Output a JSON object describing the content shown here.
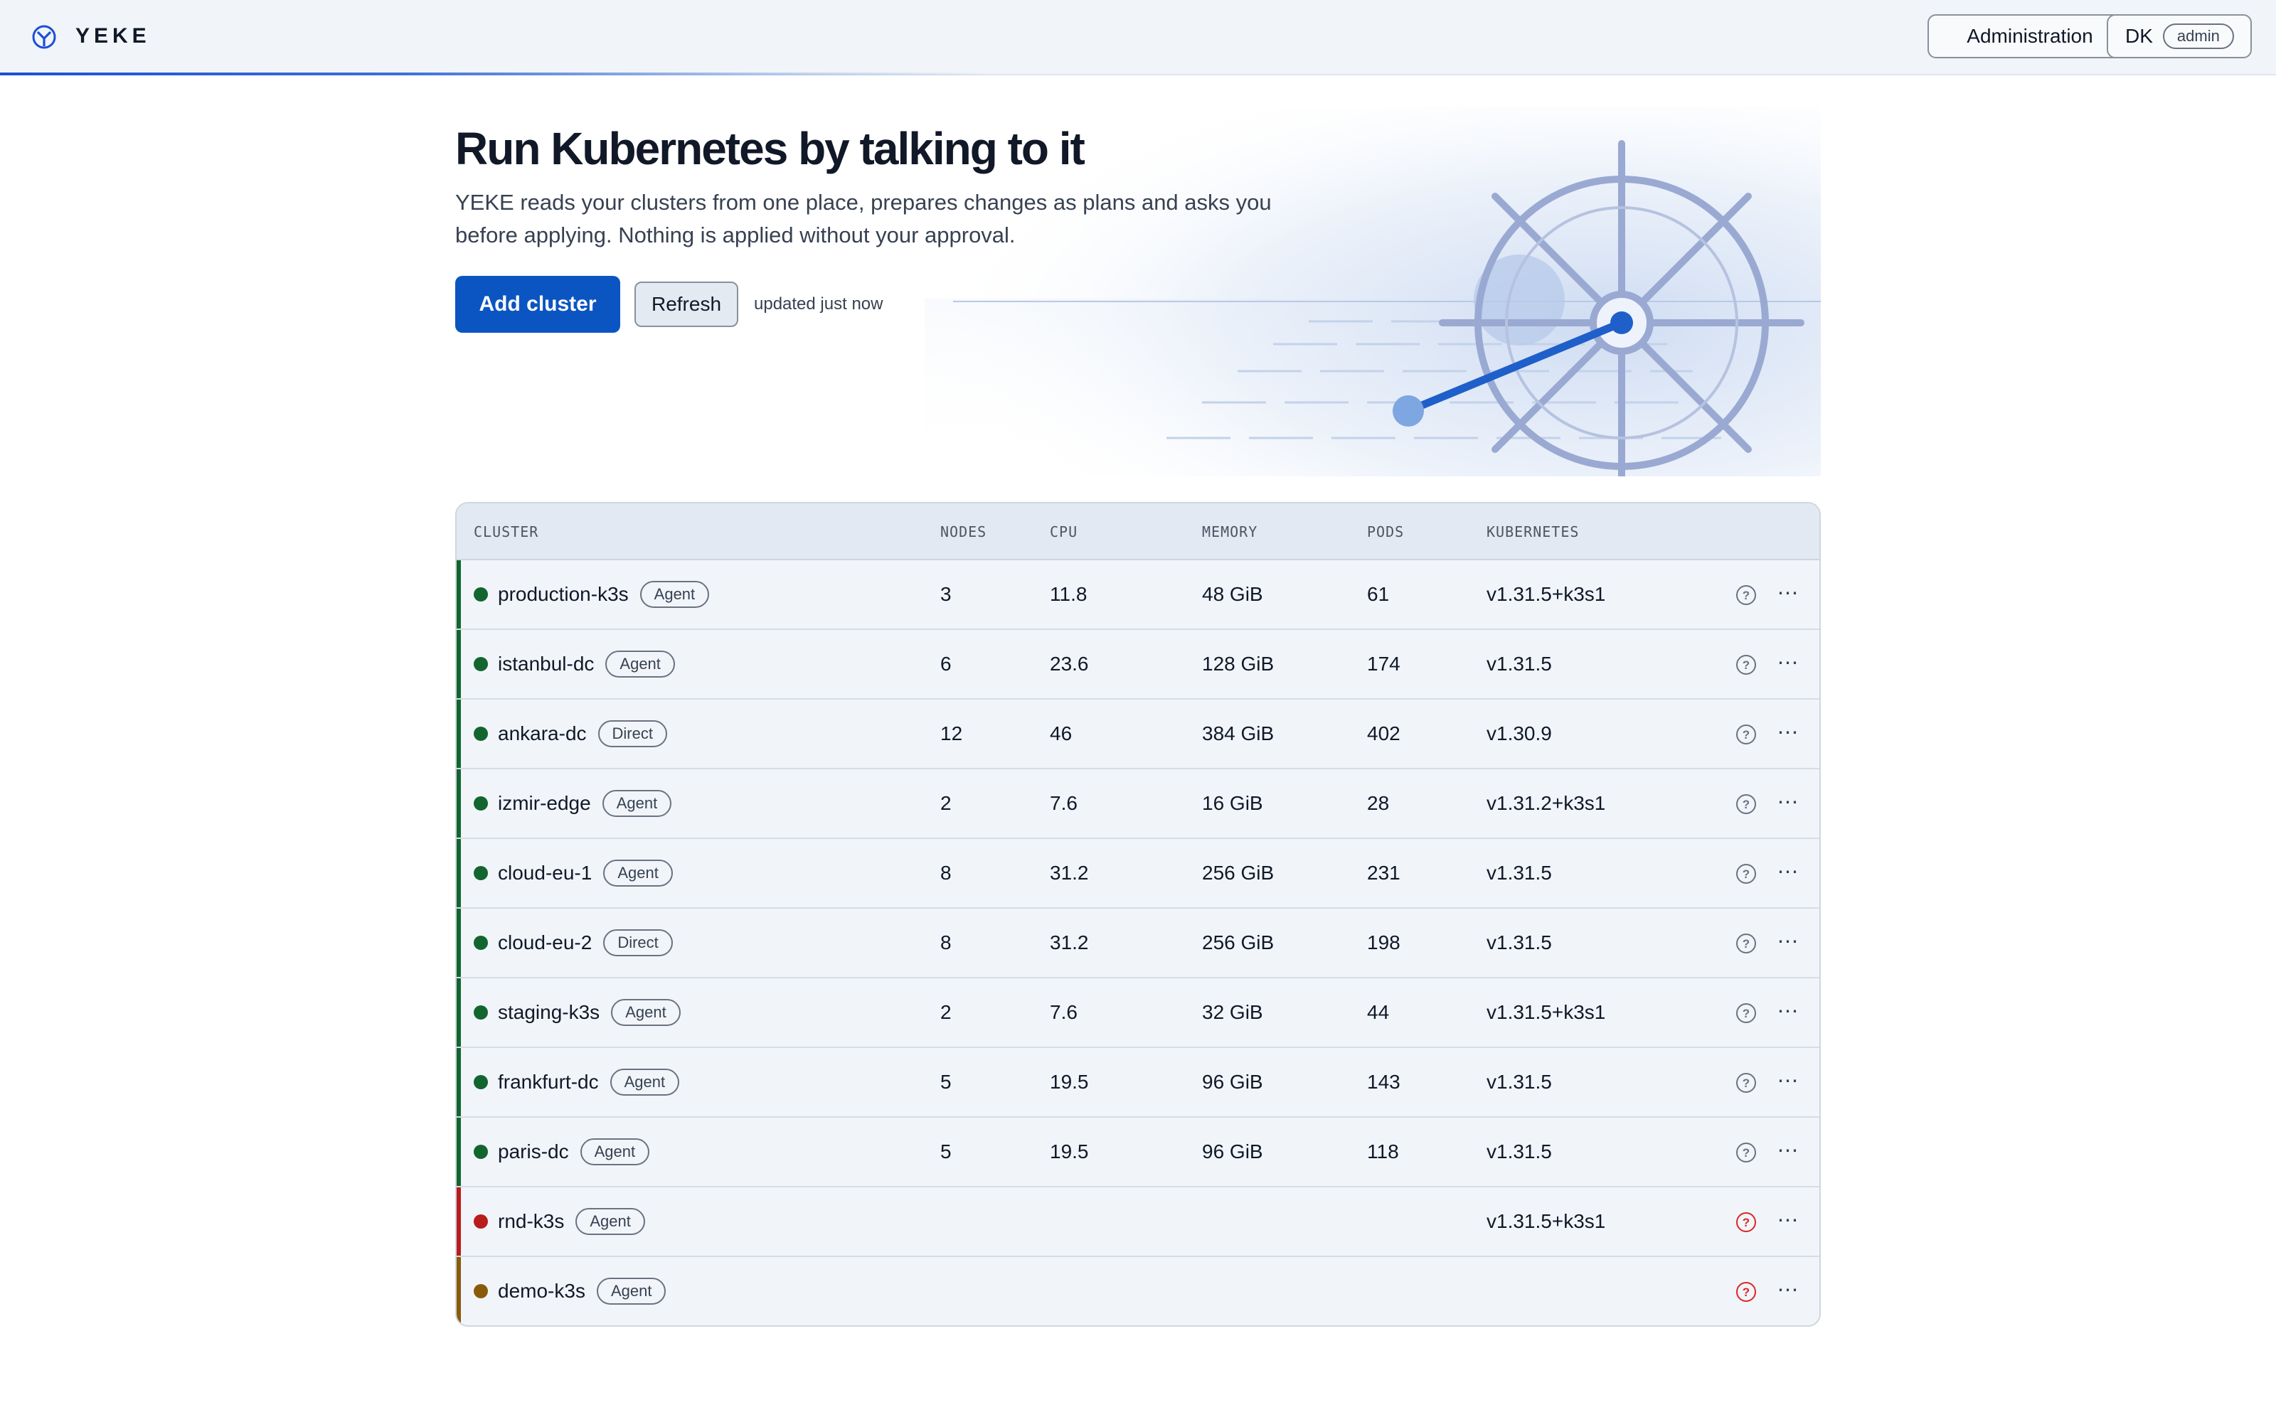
{
  "app": {
    "brand": "YEKE"
  },
  "header": {
    "admin_label": "Administration",
    "user_initials": "DK",
    "user_role": "admin"
  },
  "hero": {
    "title": "Run Kubernetes by talking to it",
    "description": "YEKE reads your clusters from one place, prepares changes as plans and asks you before applying. Nothing is applied without your approval.",
    "add_cluster_label": "Add cluster",
    "refresh_label": "Refresh",
    "updated_text": "updated just now"
  },
  "table": {
    "columns": [
      "CLUSTER",
      "NODES",
      "CPU",
      "MEMORY",
      "PODS",
      "KUBERNETES"
    ],
    "rows": [
      {
        "name": "production-k3s",
        "type": "Agent",
        "nodes": "3",
        "cpu": "11.8",
        "memory": "48 GiB",
        "pods": "61",
        "k8s": "v1.31.5+k3s1",
        "status": "healthy"
      },
      {
        "name": "istanbul-dc",
        "type": "Agent",
        "nodes": "6",
        "cpu": "23.6",
        "memory": "128 GiB",
        "pods": "174",
        "k8s": "v1.31.5",
        "status": "healthy"
      },
      {
        "name": "ankara-dc",
        "type": "Direct",
        "nodes": "12",
        "cpu": "46",
        "memory": "384 GiB",
        "pods": "402",
        "k8s": "v1.30.9",
        "status": "healthy"
      },
      {
        "name": "izmir-edge",
        "type": "Agent",
        "nodes": "2",
        "cpu": "7.6",
        "memory": "16 GiB",
        "pods": "28",
        "k8s": "v1.31.2+k3s1",
        "status": "healthy"
      },
      {
        "name": "cloud-eu-1",
        "type": "Agent",
        "nodes": "8",
        "cpu": "31.2",
        "memory": "256 GiB",
        "pods": "231",
        "k8s": "v1.31.5",
        "status": "healthy"
      },
      {
        "name": "cloud-eu-2",
        "type": "Direct",
        "nodes": "8",
        "cpu": "31.2",
        "memory": "256 GiB",
        "pods": "198",
        "k8s": "v1.31.5",
        "status": "healthy"
      },
      {
        "name": "staging-k3s",
        "type": "Agent",
        "nodes": "2",
        "cpu": "7.6",
        "memory": "32 GiB",
        "pods": "44",
        "k8s": "v1.31.5+k3s1",
        "status": "healthy"
      },
      {
        "name": "frankfurt-dc",
        "type": "Agent",
        "nodes": "5",
        "cpu": "19.5",
        "memory": "96 GiB",
        "pods": "143",
        "k8s": "v1.31.5",
        "status": "healthy"
      },
      {
        "name": "paris-dc",
        "type": "Agent",
        "nodes": "5",
        "cpu": "19.5",
        "memory": "96 GiB",
        "pods": "118",
        "k8s": "v1.31.5",
        "status": "healthy"
      },
      {
        "name": "rnd-k3s",
        "type": "Agent",
        "nodes": "",
        "cpu": "",
        "memory": "",
        "pods": "",
        "k8s": "v1.31.5+k3s1",
        "status": "error"
      },
      {
        "name": "demo-k3s",
        "type": "Agent",
        "nodes": "",
        "cpu": "",
        "memory": "",
        "pods": "",
        "k8s": "",
        "status": "warning"
      }
    ]
  },
  "colors": {
    "primary": "#0b55c2",
    "healthy": "#13652f",
    "error": "#b91c1c",
    "warning": "#8a5a0b",
    "help_ok": "#6b7280",
    "help_error": "#dc2626"
  },
  "icons": {
    "logo": "yeke-logo-icon",
    "help": "question-circle-icon",
    "more": "ellipsis-icon",
    "hero": "ship-wheel-illustration"
  }
}
